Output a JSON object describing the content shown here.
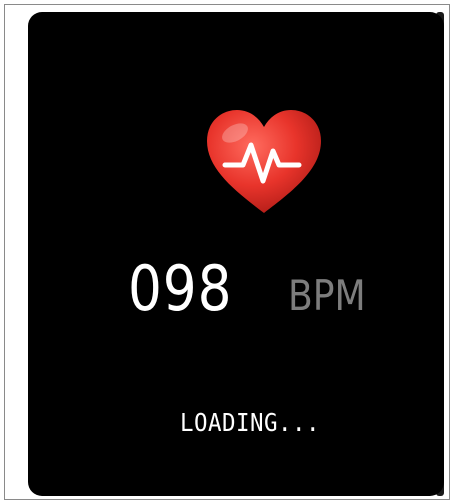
{
  "heart_rate": {
    "value": "098",
    "unit": "BPM",
    "status": "LOADING..."
  },
  "icons": {
    "heart": "heart-pulse-icon"
  },
  "colors": {
    "screen_background": "#000000",
    "heart": "#e53935",
    "value_text": "#ffffff",
    "unit_text": "#7d7d7d"
  }
}
